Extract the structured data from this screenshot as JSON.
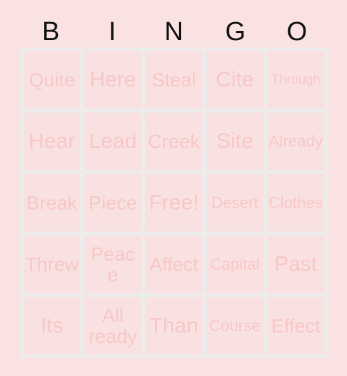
{
  "card": {
    "title": "BINGO",
    "columns": [
      "B",
      "I",
      "N",
      "G",
      "O"
    ],
    "colors": {
      "page_background": "#fae2e2",
      "cell_background": "#fae1e1",
      "grid_gutter": "#edeceb",
      "cell_text": "#f7c7c7",
      "header_text": "#111111"
    },
    "header": {
      "b": "B",
      "i": "I",
      "n": "N",
      "g": "G",
      "o": "O"
    },
    "rows": [
      [
        {
          "text": "Quite",
          "size": "len-m"
        },
        {
          "text": "Here",
          "size": "len-s"
        },
        {
          "text": "Steal",
          "size": "len-m"
        },
        {
          "text": "Cite",
          "size": "len-s"
        },
        {
          "text": "Through",
          "size": "len-xl"
        }
      ],
      [
        {
          "text": "Hear",
          "size": "len-s"
        },
        {
          "text": "Lead",
          "size": "len-s"
        },
        {
          "text": "Creek",
          "size": "len-m"
        },
        {
          "text": "Site",
          "size": "len-s"
        },
        {
          "text": "Already",
          "size": "len-l"
        }
      ],
      [
        {
          "text": "Break",
          "size": "len-m"
        },
        {
          "text": "Piece",
          "size": "len-m"
        },
        {
          "text": "Free!",
          "size": "len-s"
        },
        {
          "text": "Desert",
          "size": "len-l"
        },
        {
          "text": "Clothes",
          "size": "len-l"
        }
      ],
      [
        {
          "text": "Threw",
          "size": "len-m"
        },
        {
          "text": "Peace",
          "size": "len-m"
        },
        {
          "text": "Affect",
          "size": "len-m"
        },
        {
          "text": "Capital",
          "size": "len-l"
        },
        {
          "text": "Past",
          "size": "len-s"
        }
      ],
      [
        {
          "text": "Its",
          "size": "len-s"
        },
        {
          "text": "All ready",
          "size": "len-wrap"
        },
        {
          "text": "Than",
          "size": "len-s"
        },
        {
          "text": "Course",
          "size": "len-l"
        },
        {
          "text": "Effect",
          "size": "len-m"
        }
      ]
    ]
  }
}
